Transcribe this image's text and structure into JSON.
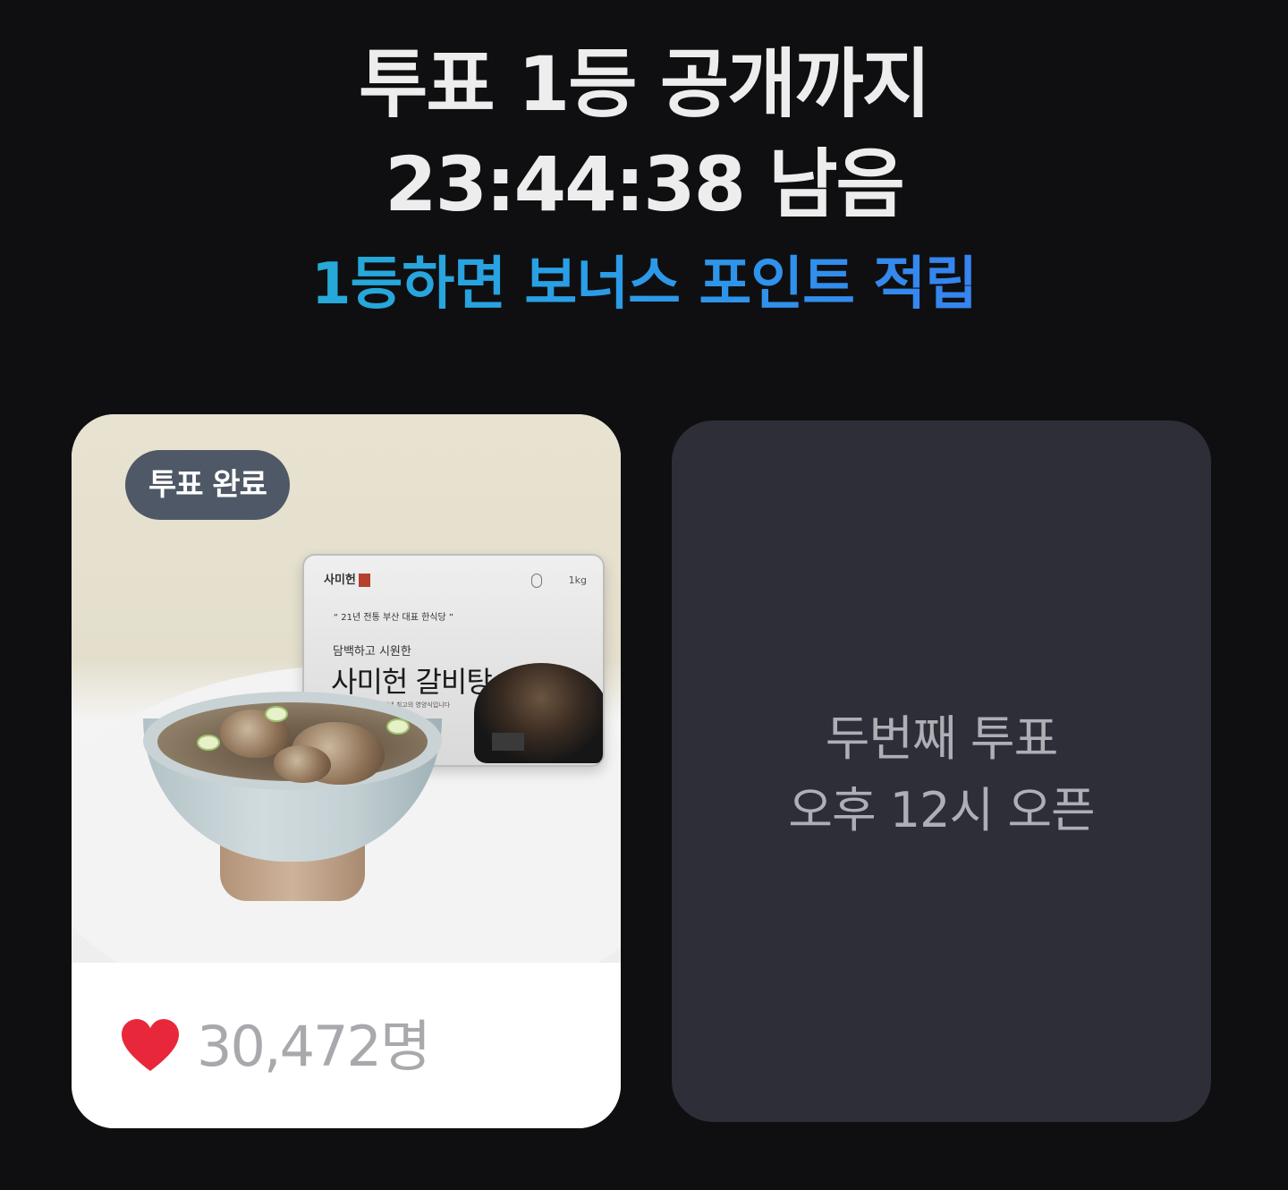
{
  "header": {
    "title_line1": "투표 1등 공개까지",
    "countdown_line": "23:44:38 남음",
    "bonus_text": "1등하면 보너스 포인트 적립"
  },
  "vote_card": {
    "badge": "투표 완료",
    "count": "30,472명",
    "heart_icon": "heart-icon",
    "image": {
      "brand": "사미헌",
      "weight": "1kg",
      "slogan": "“ 21년 전통 부산 대표 한식당 ”",
      "description": "담백하고 시원한",
      "product_name": "사미헌 갈비탕",
      "caption": "좋은 재료로 정성을 다해 끓여낸 최고의 영양식입니다"
    }
  },
  "next_card": {
    "line1": "두번째 투표",
    "line2": "오후 12시 오픈"
  },
  "colors": {
    "background": "#0f0f11",
    "title": "#ededed",
    "bonus_gradient_start": "#20b8c4",
    "bonus_gradient_end": "#3f6ff6",
    "badge_bg": "#4e5866",
    "heart": "#e8283a",
    "count_text": "#a9a9ad",
    "locked_card_bg": "#2d2e37",
    "locked_text": "#aeaeb5"
  }
}
